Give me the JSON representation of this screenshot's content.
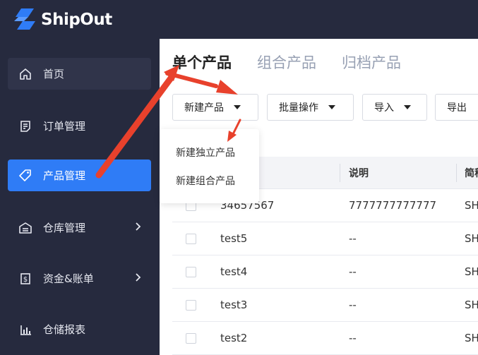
{
  "brand": {
    "name": "ShipOut",
    "color": "#2f7cf6"
  },
  "sidebar": {
    "items": [
      {
        "label": "首页",
        "icon": "home-icon"
      },
      {
        "label": "订单管理",
        "icon": "order-icon"
      },
      {
        "label": "产品管理",
        "icon": "product-tag-icon",
        "active": true
      },
      {
        "label": "仓库管理",
        "icon": "warehouse-icon",
        "expandable": true
      },
      {
        "label": "资金&账单",
        "icon": "bill-icon",
        "expandable": true
      },
      {
        "label": "仓储报表",
        "icon": "report-chart-icon"
      }
    ]
  },
  "main": {
    "tabs": [
      {
        "label": "单个产品",
        "active": true
      },
      {
        "label": "组合产品"
      },
      {
        "label": "归档产品"
      }
    ],
    "toolbar": {
      "new_product": "新建产品",
      "batch_ops": "批量操作",
      "import": "导入",
      "export": "导出"
    },
    "dropdown": {
      "items": [
        "新建独立产品",
        "新建组合产品"
      ]
    },
    "table": {
      "headers": [
        "说明",
        "简称"
      ],
      "rows": [
        {
          "sku": "34657567",
          "desc": "7777777777777",
          "short": "SH"
        },
        {
          "sku": "test5",
          "desc": "--",
          "short": "SH"
        },
        {
          "sku": "test4",
          "desc": "--",
          "short": "SH"
        },
        {
          "sku": "test3",
          "desc": "--",
          "short": "SH"
        },
        {
          "sku": "test2",
          "desc": "--",
          "short": "SH"
        }
      ]
    }
  },
  "annotation": {
    "arrow_color": "#e8412c"
  }
}
